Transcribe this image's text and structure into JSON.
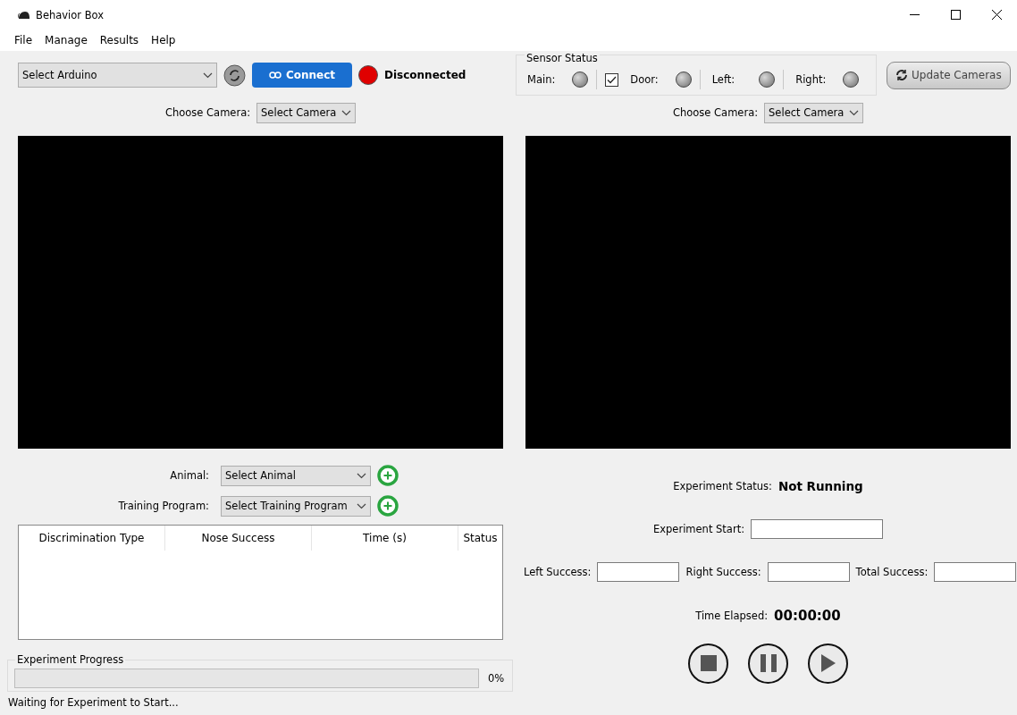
{
  "window": {
    "title": "Behavior Box"
  },
  "menu": [
    "File",
    "Manage",
    "Results",
    "Help"
  ],
  "left": {
    "arduino_select": "Select Arduino",
    "connect_button": "Connect",
    "connection": {
      "connected": false,
      "status": "Disconnected"
    },
    "camera": {
      "label": "Choose Camera:",
      "value": "Select Camera"
    },
    "animal": {
      "label": "Animal:",
      "value": "Select Animal"
    },
    "training_program": {
      "label": "Training Program:",
      "value": "Select Training Program"
    },
    "table": {
      "columns": [
        "Discrimination Type",
        "Nose Success",
        "Time (s)",
        "Status"
      ]
    },
    "progress": {
      "title": "Experiment Progress",
      "level": 0,
      "reading": "0%"
    }
  },
  "right": {
    "sensor_status": {
      "title": "Sensor Status",
      "checkbox": {
        "checked": true
      },
      "sensors": [
        {
          "label": "Main:",
          "on": false
        },
        {
          "label": "Door:",
          "on": false
        },
        {
          "label": "Left:",
          "on": false
        },
        {
          "label": "Right:",
          "on": false
        }
      ]
    },
    "update_cameras_button": "Update Cameras",
    "camera": {
      "label": "Choose Camera:",
      "value": "Select Camera"
    },
    "experiment_status": {
      "label": "Experiment Status:",
      "value": "Not Running"
    },
    "experiment_start": {
      "label": "Experiment Start:"
    },
    "successes": [
      {
        "label": "Left Success:"
      },
      {
        "label": "Right Success:"
      },
      {
        "label": "Total Success:"
      }
    ],
    "time_elapsed": {
      "label": "Time Elapsed:",
      "value": "00:00:00"
    },
    "controls": [
      {
        "kind": "stop"
      },
      {
        "kind": "pause"
      },
      {
        "kind": "play"
      }
    ]
  },
  "status_bar": "Waiting for Experiment to Start..."
}
